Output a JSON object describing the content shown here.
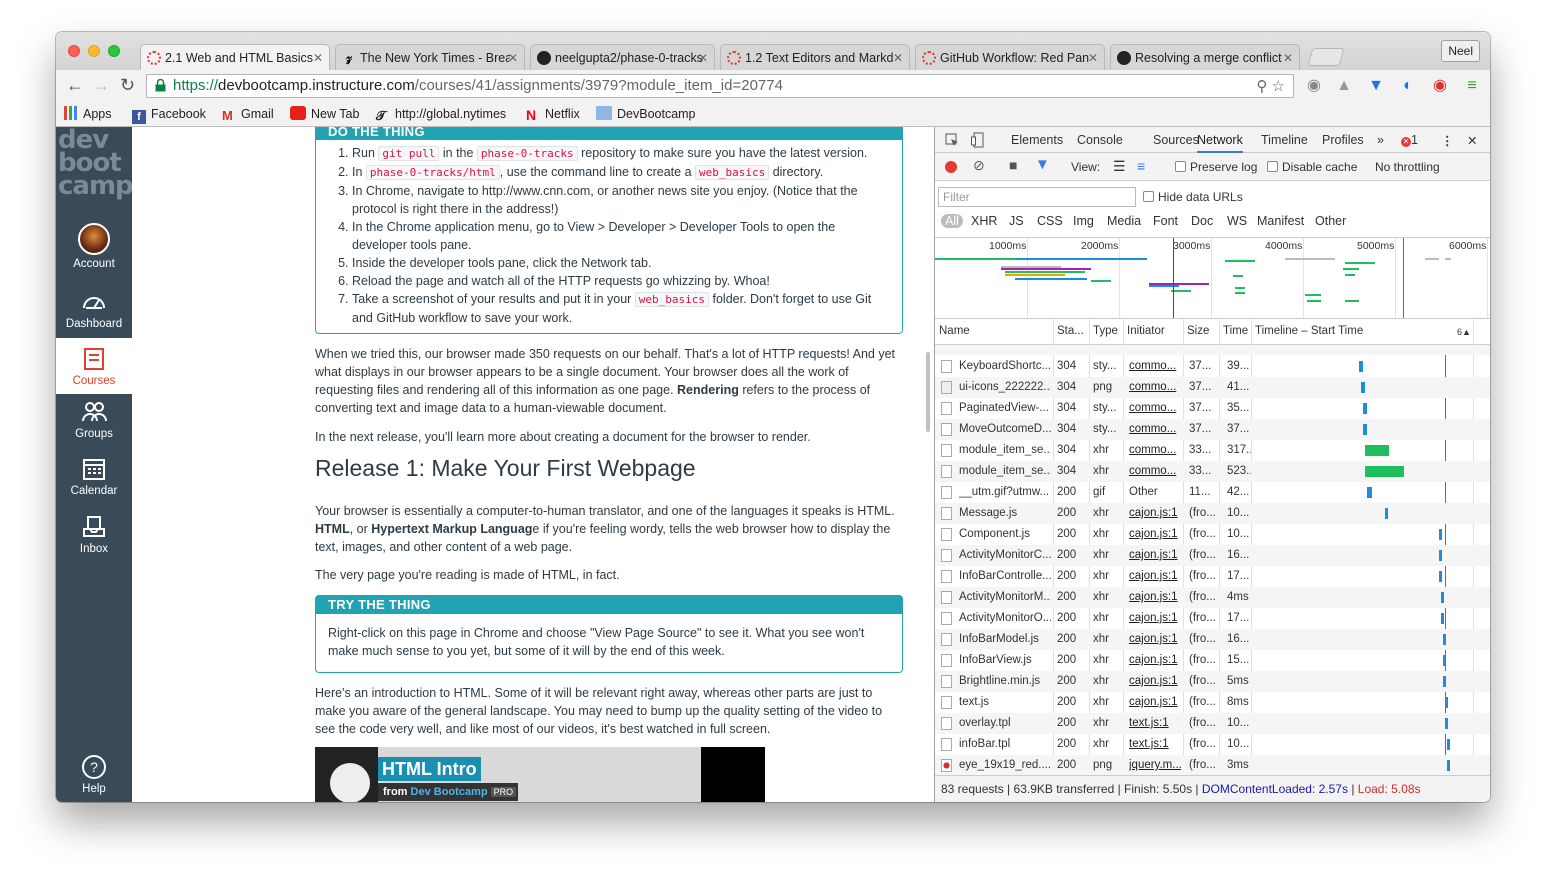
{
  "browser": {
    "tabs": [
      {
        "title": "2.1 Web and HTML Basics",
        "icon": "canvas-icon",
        "active": true
      },
      {
        "title": "The New York Times - Brea",
        "icon": "nyt-icon",
        "active": false
      },
      {
        "title": "neelgupta2/phase-0-tracks",
        "icon": "github-icon",
        "active": false
      },
      {
        "title": "1.2 Text Editors and Markd",
        "icon": "canvas-icon",
        "active": false
      },
      {
        "title": "GitHub Workflow: Red Pan",
        "icon": "canvas-icon",
        "active": false
      },
      {
        "title": "Resolving a merge conflict",
        "icon": "github-icon",
        "active": false
      }
    ],
    "profile": "Neel",
    "url_scheme": "https://",
    "url_host": "devbootcamp.instructure.com",
    "url_path": "/courses/41/assignments/3979?module_item_id=20774",
    "bookmarks": [
      {
        "label": "Apps",
        "icon": "apps-icon"
      },
      {
        "label": "Facebook",
        "icon": "facebook-icon"
      },
      {
        "label": "Gmail",
        "icon": "gmail-icon"
      },
      {
        "label": "New Tab",
        "icon": "youtube-icon"
      },
      {
        "label": "http://global.nytimes",
        "icon": "nyt-icon"
      },
      {
        "label": "Netflix",
        "icon": "netflix-icon"
      },
      {
        "label": "DevBootcamp",
        "icon": "folder-icon"
      }
    ]
  },
  "lms_nav": {
    "logo": [
      "dev",
      "boot",
      "camp"
    ],
    "items": [
      {
        "label": "Account",
        "icon": "avatar"
      },
      {
        "label": "Dashboard",
        "icon": "dashboard-icon"
      },
      {
        "label": "Courses",
        "icon": "courses-icon",
        "active": true
      },
      {
        "label": "Groups",
        "icon": "groups-icon"
      },
      {
        "label": "Calendar",
        "icon": "calendar-icon"
      },
      {
        "label": "Inbox",
        "icon": "inbox-icon"
      },
      {
        "label": "Help",
        "icon": "help-icon"
      }
    ]
  },
  "content": {
    "do_thing": {
      "heading": "DO THE THING",
      "steps": [
        {
          "parts": [
            "Run ",
            {
              "code": "git pull"
            },
            " in the ",
            {
              "code": "phase-0-tracks"
            },
            " repository to make sure you have the latest version."
          ]
        },
        {
          "parts": [
            "In ",
            {
              "code": "phase-0-tracks/html"
            },
            ", use the command line to create a ",
            {
              "code": "web_basics"
            },
            " directory."
          ]
        },
        {
          "parts": [
            "In Chrome, navigate to http://www.cnn.com, or another news site you enjoy. (Notice that the protocol is right there in the address!)"
          ]
        },
        {
          "parts": [
            "In the Chrome application menu, go to View > Developer > Developer Tools to open the developer tools pane."
          ]
        },
        {
          "parts": [
            "Inside the developer tools pane, click the Network tab."
          ]
        },
        {
          "parts": [
            "Reload the page and watch all of the HTTP requests go whizzing by. Whoa!"
          ]
        },
        {
          "parts": [
            "Take a screenshot of your results and put it in your ",
            {
              "code": "web_basics"
            },
            " folder. Don't forget to use Git and GitHub workflow to save your work."
          ]
        }
      ]
    },
    "para1_before": "When we tried this, our browser made 350 requests on our behalf. That's a lot of HTTP requests! And yet what displays in our browser appears to be a single document. Your browser does all the work of requesting files and rendering all of this information as one page. ",
    "para1_bold": "Rendering",
    "para1_after": " refers to the process of converting text and image data to a human-viewable document.",
    "para2": "In the next release, you'll learn more about creating a document for the browser to render.",
    "release_heading": "Release 1: Make Your First Webpage",
    "para3_a": "Your browser is essentially a computer-to-human translator, and one of the languages it speaks is HTML. ",
    "para3_b": "HTML",
    "para3_c": ", or ",
    "para3_d": "Hypertext Markup Languag",
    "para3_e": "e if you're feeling wordy, tells the web browser how to display the text, images, and other content of a web page.",
    "para4": "The very page you're reading is made of HTML, in fact.",
    "try_thing": {
      "heading": "TRY THE THING",
      "body": "Right-click on this page in Chrome and choose \"View Page Source\" to see it. What you see won't make much sense to you yet, but some of it will by the end of this week."
    },
    "para5": "Here's an introduction to HTML. Some of it will be relevant right away, whereas other parts are just to make you aware of the general landscape. You may need to bump up the quality setting of the video to see the code very well, and like most of our videos, it's best watched in full screen.",
    "video": {
      "title": "HTML Intro",
      "from": "from",
      "brand": "Dev Bootcamp",
      "badge": "PRO"
    }
  },
  "devtools": {
    "tabs": [
      "Elements",
      "Console",
      "Sources",
      "Network",
      "Timeline",
      "Profiles"
    ],
    "active_tab": "Network",
    "more": "»",
    "error_count": "1",
    "view_label": "View:",
    "preserve_log": "Preserve log",
    "disable_cache": "Disable cache",
    "throttling": "No throttling",
    "filter_placeholder": "Filter",
    "hide_data_urls": "Hide data URLs",
    "types": [
      "All",
      "XHR",
      "JS",
      "CSS",
      "Img",
      "Media",
      "Font",
      "Doc",
      "WS",
      "Manifest",
      "Other"
    ],
    "overview_ticks": [
      "1000ms",
      "2000ms",
      "3000ms",
      "4000ms",
      "5000ms",
      "6000ms"
    ],
    "columns": [
      "Name",
      "Sta...",
      "Type",
      "Initiator",
      "Size",
      "Time",
      "Timeline – Start Time"
    ],
    "timeline_col_num": "6",
    "rows": [
      {
        "name": "KeyboardShortc...",
        "status": "304",
        "type": "sty...",
        "initiator": "commo...",
        "link": true,
        "size": "37...",
        "time": "39...",
        "wf_start": 0.48,
        "wf_len": 0.02,
        "color": "#1a8fd8"
      },
      {
        "name": "ui-icons_222222...",
        "status": "304",
        "type": "png",
        "initiator": "commo...",
        "link": true,
        "size": "37...",
        "time": "41...",
        "wf_start": 0.49,
        "wf_len": 0.02,
        "color": "#1a8fd8"
      },
      {
        "name": "PaginatedView-...",
        "status": "304",
        "type": "sty...",
        "initiator": "commo...",
        "link": true,
        "size": "37...",
        "time": "35...",
        "wf_start": 0.5,
        "wf_len": 0.02,
        "color": "#1a8fd8"
      },
      {
        "name": "MoveOutcomeD...",
        "status": "304",
        "type": "sty...",
        "initiator": "commo...",
        "link": true,
        "size": "37...",
        "time": "37...",
        "wf_start": 0.5,
        "wf_len": 0.02,
        "color": "#1a8fd8"
      },
      {
        "name": "module_item_se...",
        "status": "304",
        "type": "xhr",
        "initiator": "commo...",
        "link": true,
        "size": "33...",
        "time": "317...",
        "wf_start": 0.51,
        "wf_len": 0.11,
        "color": "#1fbf5f"
      },
      {
        "name": "module_item_se...",
        "status": "304",
        "type": "xhr",
        "initiator": "commo...",
        "link": true,
        "size": "33...",
        "time": "523...",
        "wf_start": 0.51,
        "wf_len": 0.18,
        "color": "#1fbf5f"
      },
      {
        "name": "__utm.gif?utmw...",
        "status": "200",
        "type": "gif",
        "initiator": "Other",
        "link": false,
        "size": "11...",
        "time": "42...",
        "wf_start": 0.52,
        "wf_len": 0.02,
        "color": "#1a8fd8"
      },
      {
        "name": "Message.js",
        "status": "200",
        "type": "xhr",
        "initiator": "cajon.js:1",
        "link": true,
        "size": "(fro...",
        "time": "10...",
        "wf_start": 0.6,
        "wf_len": 0.01,
        "color": "#1a8fd8"
      },
      {
        "name": "Component.js",
        "status": "200",
        "type": "xhr",
        "initiator": "cajon.js:1",
        "link": true,
        "size": "(fro...",
        "time": "10...",
        "wf_start": 0.85,
        "wf_len": 0.01,
        "color": "#1a8fd8"
      },
      {
        "name": "ActivityMonitorC...",
        "status": "200",
        "type": "xhr",
        "initiator": "cajon.js:1",
        "link": true,
        "size": "(fro...",
        "time": "16...",
        "wf_start": 0.85,
        "wf_len": 0.01,
        "color": "#1a8fd8"
      },
      {
        "name": "InfoBarControlle...",
        "status": "200",
        "type": "xhr",
        "initiator": "cajon.js:1",
        "link": true,
        "size": "(fro...",
        "time": "17...",
        "wf_start": 0.85,
        "wf_len": 0.01,
        "color": "#1a8fd8"
      },
      {
        "name": "ActivityMonitorM...",
        "status": "200",
        "type": "xhr",
        "initiator": "cajon.js:1",
        "link": true,
        "size": "(fro...",
        "time": "4ms",
        "wf_start": 0.86,
        "wf_len": 0.01,
        "color": "#1a8fd8"
      },
      {
        "name": "ActivityMonitorO...",
        "status": "200",
        "type": "xhr",
        "initiator": "cajon.js:1",
        "link": true,
        "size": "(fro...",
        "time": "17...",
        "wf_start": 0.86,
        "wf_len": 0.01,
        "color": "#1a8fd8"
      },
      {
        "name": "InfoBarModel.js",
        "status": "200",
        "type": "xhr",
        "initiator": "cajon.js:1",
        "link": true,
        "size": "(fro...",
        "time": "16...",
        "wf_start": 0.87,
        "wf_len": 0.01,
        "color": "#1a8fd8"
      },
      {
        "name": "InfoBarView.js",
        "status": "200",
        "type": "xhr",
        "initiator": "cajon.js:1",
        "link": true,
        "size": "(fro...",
        "time": "15...",
        "wf_start": 0.87,
        "wf_len": 0.01,
        "color": "#1a8fd8"
      },
      {
        "name": "Brightline.min.js",
        "status": "200",
        "type": "xhr",
        "initiator": "cajon.js:1",
        "link": true,
        "size": "(fro...",
        "time": "5ms",
        "wf_start": 0.87,
        "wf_len": 0.01,
        "color": "#1a8fd8"
      },
      {
        "name": "text.js",
        "status": "200",
        "type": "xhr",
        "initiator": "cajon.js:1",
        "link": true,
        "size": "(fro...",
        "time": "8ms",
        "wf_start": 0.88,
        "wf_len": 0.01,
        "color": "#1a8fd8"
      },
      {
        "name": "overlay.tpl",
        "status": "200",
        "type": "xhr",
        "initiator": "text.js:1",
        "link": true,
        "size": "(fro...",
        "time": "10...",
        "wf_start": 0.88,
        "wf_len": 0.01,
        "color": "#1a8fd8"
      },
      {
        "name": "infoBar.tpl",
        "status": "200",
        "type": "xhr",
        "initiator": "text.js:1",
        "link": true,
        "size": "(fro...",
        "time": "10...",
        "wf_start": 0.89,
        "wf_len": 0.01,
        "color": "#1a8fd8"
      },
      {
        "name": "eye_19x19_red....",
        "status": "200",
        "type": "png",
        "initiator": "jquery.m...",
        "link": true,
        "size": "(fro...",
        "time": "3ms",
        "wf_start": 0.89,
        "wf_len": 0.01,
        "color": "#1a8fd8"
      }
    ],
    "status_requests": "83 requests",
    "status_transferred": "63.9KB transferred",
    "status_finish": "Finish: 5.50s",
    "status_dcl": "DOMContentLoaded: 2.57s",
    "status_load": "Load: 5.08s",
    "status_sep": " | "
  }
}
